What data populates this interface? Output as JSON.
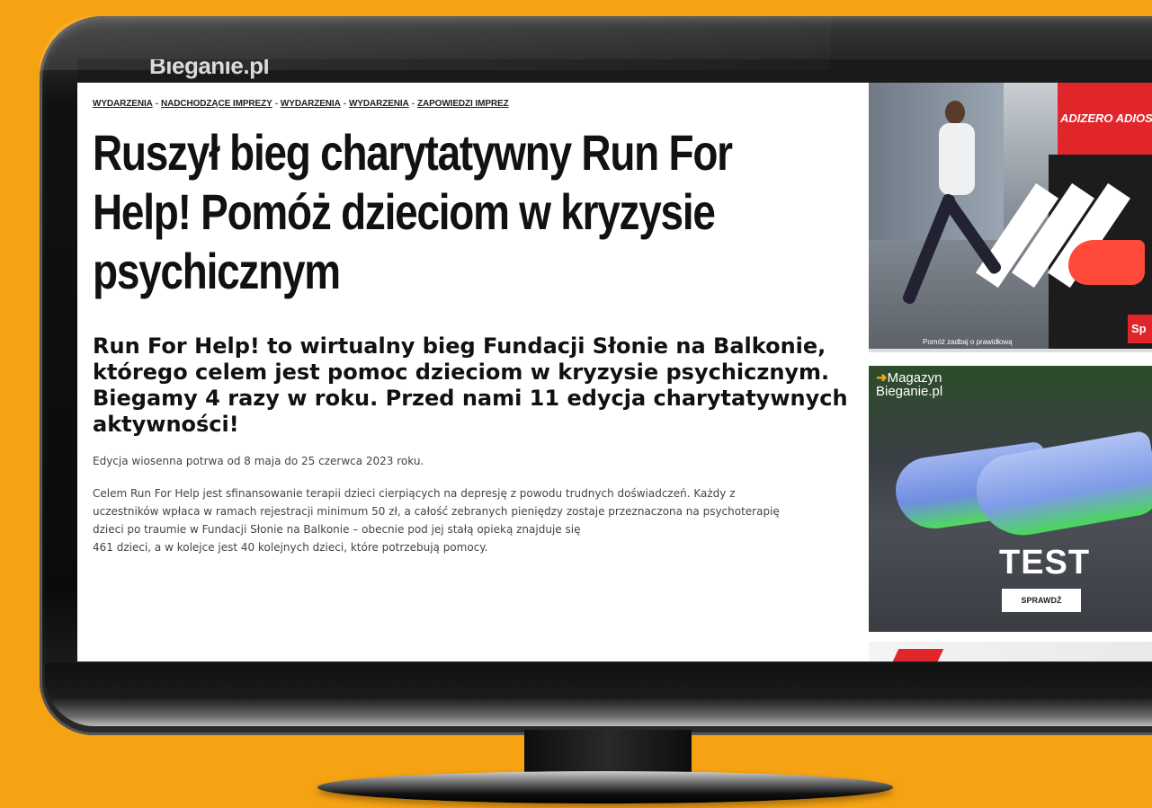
{
  "site": {
    "logo": "Bieganie.pl"
  },
  "breadcrumb": [
    "WYDARZENIA",
    "NADCHODZĄCE IMPREZY",
    "WYDARZENIA",
    "WYDARZENIA",
    "ZAPOWIEDZI IMPREZ"
  ],
  "breadcrumb_separator": "-",
  "article": {
    "title": "Ruszył bieg charytatywny Run For Help! Pomóż dzieciom w kryzysie psychicznym",
    "lead": "Run For Help! to wirtualny bieg Fundacji Słonie na Balkonie, którego celem jest pomoc dzieciom w kryzysie psychicznym. Biegamy 4 razy w roku. Przed nami 11 edycja charytatywnych aktywności!",
    "paragraph1": "Edycja wiosenna potrwa od 8 maja do 25 czerwca 2023 roku.",
    "paragraph2": "Celem Run For Help jest sfinansowanie terapii dzieci cierpiących na depresję z powodu trudnych doświadczeń. Każdy z uczestników wpłaca w ramach rejestracji minimum 50 zł, a całość zebranych pieniędzy zostaje przeznaczona na psychoterapię dzieci po traumie w Fundacji Słonie na Balkonie – obecnie pod jej stałą opieką znajduje się",
    "paragraph3": "461 dzieci, a w kolejce jest 40 kolejnych dzieci, które potrzebują pomocy."
  },
  "ads": {
    "ad1": {
      "headline": "ADIZERO ADIOS P",
      "badge": "Sp",
      "caption": "Pomóż zadbaj o prawidłową"
    },
    "ad2": {
      "magazine_arrow": "➜",
      "magazine_line1": "Magazyn",
      "magazine_line2": "Bieganie.pl",
      "test_label": "TEST",
      "button_label": "SPRAWDŹ"
    }
  },
  "colors": {
    "background": "#f6a313",
    "accent_red": "#e0262a",
    "text_dark": "#111111"
  }
}
